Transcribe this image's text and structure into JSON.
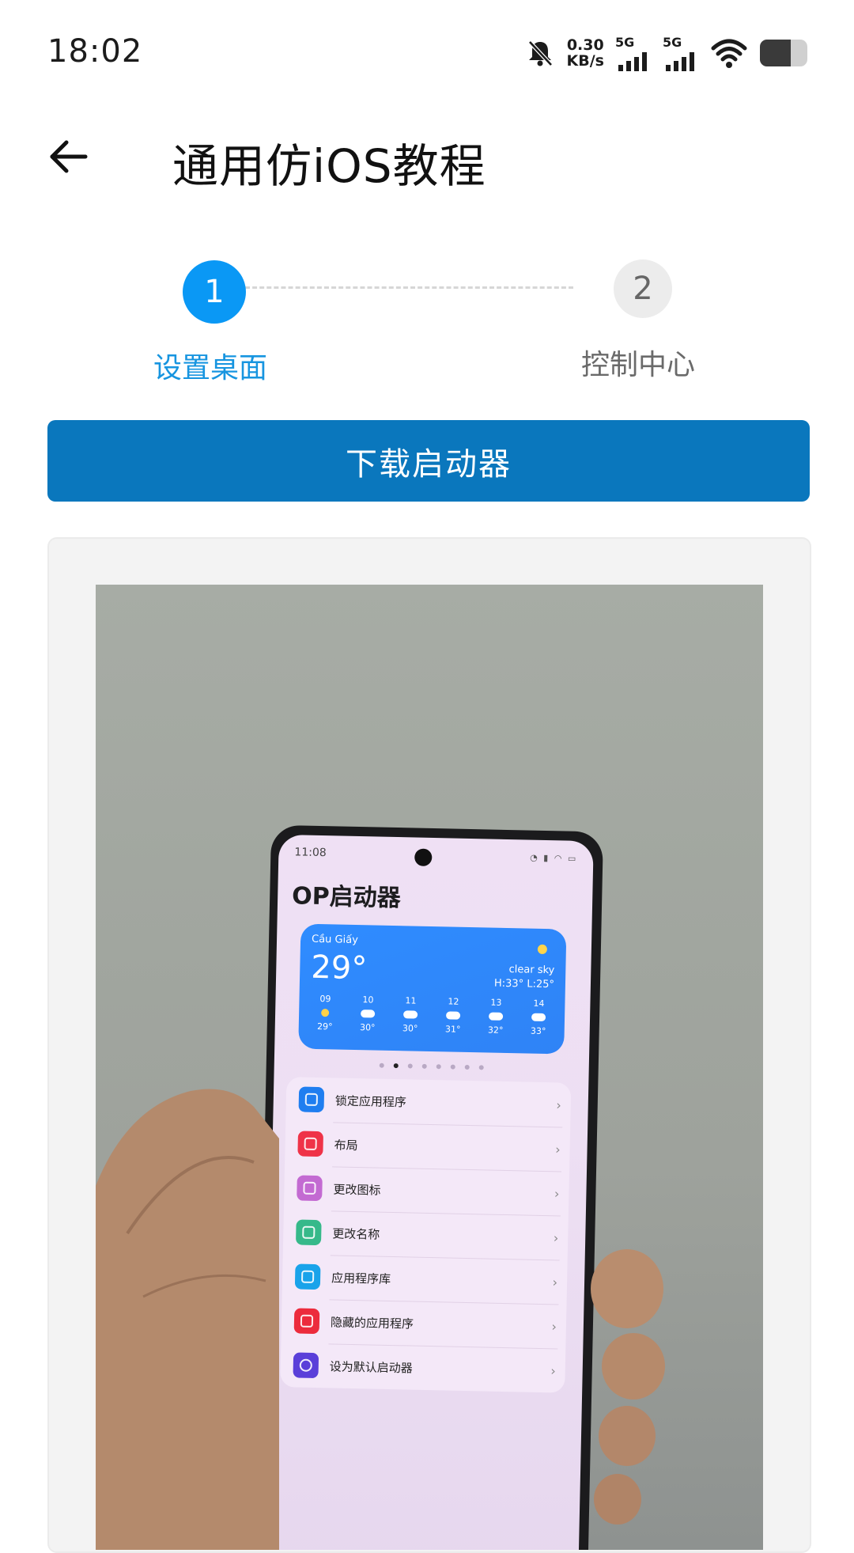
{
  "status_bar": {
    "time": "18:02",
    "speed_value": "0.30",
    "speed_unit": "KB/s",
    "network_1": "5G",
    "network_2": "5G",
    "icons": [
      "bell-muted-icon",
      "signal-icon",
      "signal-icon",
      "wifi-icon",
      "battery-icon"
    ]
  },
  "header": {
    "title": "通用仿iOS教程",
    "back_icon": "arrow-left-icon"
  },
  "stepper": {
    "steps": [
      {
        "number": "1",
        "label": "设置桌面",
        "active": true
      },
      {
        "number": "2",
        "label": "控制中心",
        "active": false
      }
    ]
  },
  "download_button": {
    "label": "下载启动器"
  },
  "colors": {
    "accent": "#0a98f5",
    "button": "#0a77bd",
    "active_label": "#1795e0",
    "inactive_label": "#6a6a6a"
  },
  "tutorial_image": {
    "phone_time": "11:08",
    "app_title": "OP启动器",
    "weather": {
      "location": "Cầu Giấy",
      "temperature": "29°",
      "description": "clear sky",
      "high_low": "H:33° L:25°",
      "forecast": [
        {
          "hour": "09",
          "temp": "29°",
          "icon": "sun"
        },
        {
          "hour": "10",
          "temp": "30°",
          "icon": "cloud"
        },
        {
          "hour": "11",
          "temp": "30°",
          "icon": "cloud"
        },
        {
          "hour": "12",
          "temp": "31°",
          "icon": "cloud"
        },
        {
          "hour": "13",
          "temp": "32°",
          "icon": "cloud"
        },
        {
          "hour": "14",
          "temp": "33°",
          "icon": "cloud"
        }
      ]
    },
    "menu_items": [
      {
        "label": "锁定应用程序",
        "color": "#1f7ef0",
        "icon": "lock-icon"
      },
      {
        "label": "布局",
        "color": "#ef3348",
        "icon": "grid-icon"
      },
      {
        "label": "更改图标",
        "color": "#c36ad2",
        "icon": "instagram-icon"
      },
      {
        "label": "更改名称",
        "color": "#36b98a",
        "icon": "list-icon"
      },
      {
        "label": "应用程序库",
        "color": "#19a3ea",
        "icon": "apps-icon"
      },
      {
        "label": "隐藏的应用程序",
        "color": "#ec2b3c",
        "icon": "eye-icon"
      },
      {
        "label": "设为默认启动器",
        "color": "#5a3fd9",
        "icon": "circle-icon"
      }
    ]
  }
}
